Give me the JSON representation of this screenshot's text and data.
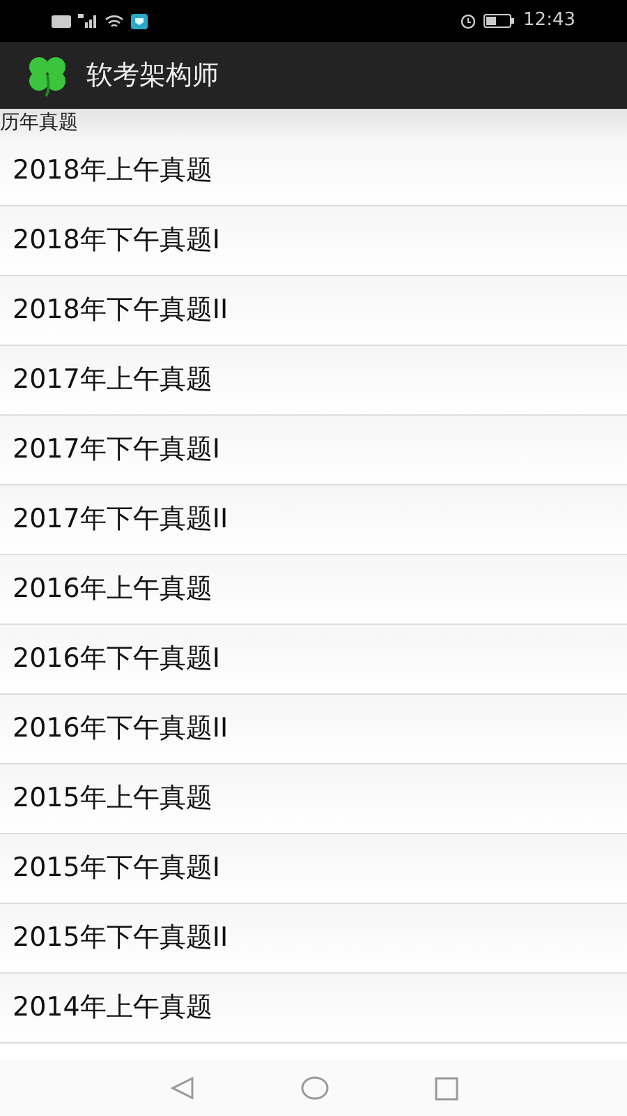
{
  "status_bar": {
    "time": "12:43"
  },
  "app_bar": {
    "title": "软考架构师"
  },
  "section": {
    "title": "历年真题"
  },
  "items": [
    {
      "label": "2018年上午真题"
    },
    {
      "label": "2018年下午真题I"
    },
    {
      "label": "2018年下午真题II"
    },
    {
      "label": "2017年上午真题"
    },
    {
      "label": "2017年下午真题I"
    },
    {
      "label": "2017年下午真题II"
    },
    {
      "label": "2016年上午真题"
    },
    {
      "label": "2016年下午真题I"
    },
    {
      "label": "2016年下午真题II"
    },
    {
      "label": "2015年上午真题"
    },
    {
      "label": "2015年下午真题I"
    },
    {
      "label": "2015年下午真题II"
    },
    {
      "label": "2014年上午真题"
    }
  ]
}
